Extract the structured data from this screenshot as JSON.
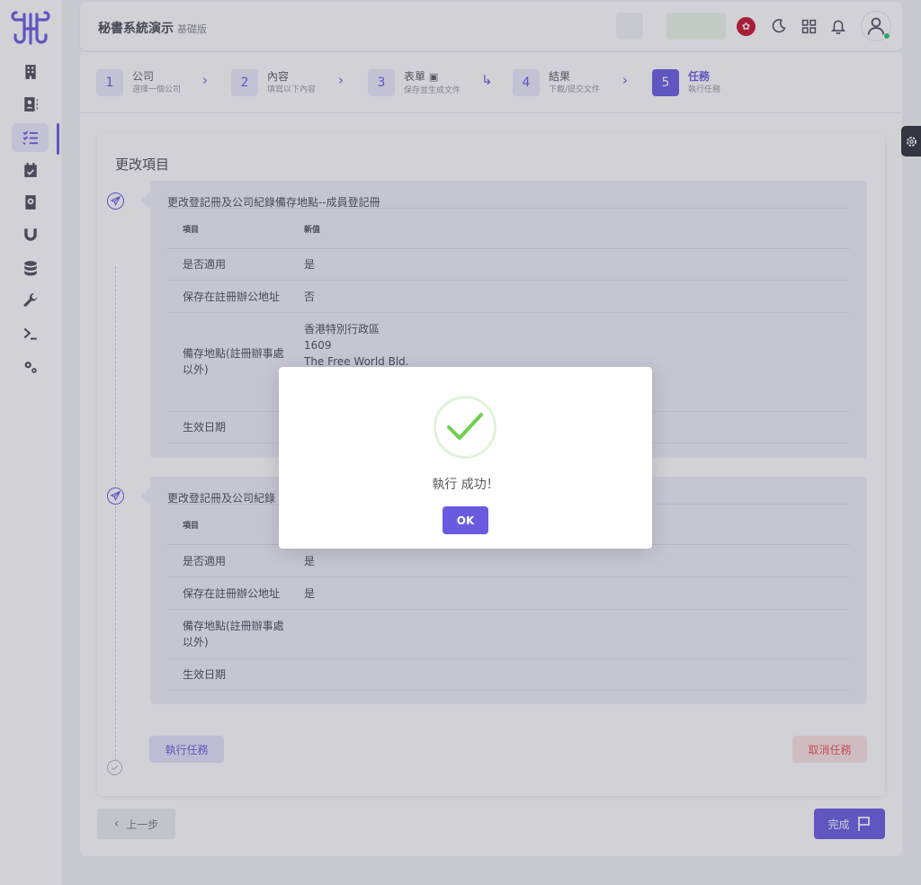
{
  "header": {
    "app_title": "秘書系統演示",
    "app_edition": "基礎版"
  },
  "sidebar": {
    "items": [
      {
        "icon": "building-icon",
        "active": false
      },
      {
        "icon": "contacts-icon",
        "active": false
      },
      {
        "icon": "task-list-icon",
        "active": true
      },
      {
        "icon": "calendar-check-icon",
        "active": false
      },
      {
        "icon": "address-book-icon",
        "active": false
      },
      {
        "icon": "magnet-icon",
        "active": false
      },
      {
        "icon": "database-icon",
        "active": false
      },
      {
        "icon": "wrench-icon",
        "active": false
      },
      {
        "icon": "terminal-icon",
        "active": false
      },
      {
        "icon": "cogs-icon",
        "active": false
      }
    ]
  },
  "stepper": {
    "steps": [
      {
        "num": "1",
        "title": "公司",
        "sub": "選擇一個公司"
      },
      {
        "num": "2",
        "title": "內容",
        "sub": "填寫以下內容"
      },
      {
        "num": "3",
        "title": "表單",
        "sub": "保存並生成文件"
      },
      {
        "num": "4",
        "title": "結果",
        "sub": "下載/提交文件"
      },
      {
        "num": "5",
        "title": "任務",
        "sub": "執行任務"
      }
    ]
  },
  "main": {
    "section_title": "更改項目",
    "blocks": [
      {
        "title": "更改登記冊及公司紀錄備存地點--成員登記冊",
        "col_item": "項目",
        "col_new": "新值",
        "rows": [
          {
            "item": "是否適用",
            "value": "是"
          },
          {
            "item": "保存在註冊辦公地址",
            "value": "否"
          },
          {
            "item": "備存地點(註冊辦事處以外)",
            "value_lines": [
              "香港特別行政區",
              "1609",
              "The Free World Bld."
            ]
          },
          {
            "item": "生效日期",
            "value": ""
          }
        ]
      },
      {
        "title": "更改登記冊及公司紀錄",
        "col_item": "項目",
        "col_new": "",
        "rows": [
          {
            "item": "是否適用",
            "value": "是"
          },
          {
            "item": "保存在註冊辦公地址",
            "value": "是"
          },
          {
            "item": "備存地點(註冊辦事處以外)",
            "value": ""
          },
          {
            "item": "生效日期",
            "value": ""
          }
        ]
      }
    ],
    "exec_button": "執行任務",
    "cancel_button": "取消任務",
    "prev_button": "上一步",
    "finish_button": "完成"
  },
  "modal": {
    "message": "執行 成功！",
    "ok_button": "OK",
    "icon": "success-check-icon"
  },
  "colors": {
    "accent": "#6a5ae0",
    "danger": "#ea5455",
    "success": "#6fcf4a"
  }
}
